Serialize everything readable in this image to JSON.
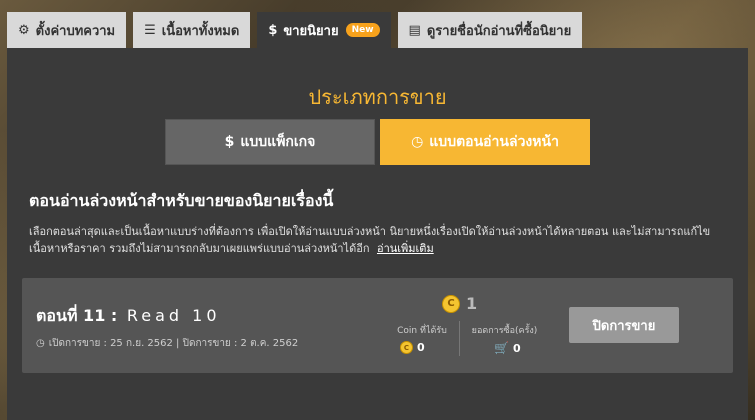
{
  "tabs": [
    {
      "icon": "gear-icon",
      "label": "ตั้งค่าบทความ"
    },
    {
      "icon": "list-icon",
      "label": "เนื้อหาทั้งหมด"
    },
    {
      "icon": "dollar-icon",
      "label": "ขายนิยาย",
      "badge": "New"
    },
    {
      "icon": "document-icon",
      "label": "ดูรายชื่อนักอ่านที่ซื้อนิยาย"
    }
  ],
  "sale_type": {
    "heading": "ประเภทการขาย",
    "package_label": "แบบแพ็กเกจ",
    "advance_label": "แบบตอนอ่านล่วงหน้า",
    "selected": "advance"
  },
  "section": {
    "title": "ตอนอ่านล่วงหน้าสำหรับขายของนิยายเรื่องนี้",
    "description": "เลือกตอนล่าสุดและเป็นเนื้อหาแบบร่างที่ต้องการ เพื่อเปิดให้อ่านแบบล่วงหน้า นิยายหนึ่งเรื่องเปิดให้อ่านล่วงหน้าได้หลายตอน และไม่สามารถแก้ไขเนื้อหาหรือราคา รวมถึงไม่สามารถกลับมาเผยแพร่แบบอ่านล่วงหน้าได้อีก",
    "more_link": "อ่านเพิ่มเติม"
  },
  "episode": {
    "number_label": "ตอนที่ 11 :",
    "name": "Read 10",
    "dates": "เปิดการขาย : 25 ก.ย. 2562 | ปิดการขาย : 2 ต.ค. 2562",
    "price": "1",
    "coin_label": "Coin ที่ได้รับ",
    "coin_value": "0",
    "sales_label": "ยอดการซื้อ(ครั้ง)",
    "sales_value": "0",
    "close_button": "ปิดการขาย"
  },
  "colors": {
    "accent": "#f7b733",
    "badge": "#f7a21c",
    "panel": "#3a3a3a",
    "card": "#555555"
  }
}
